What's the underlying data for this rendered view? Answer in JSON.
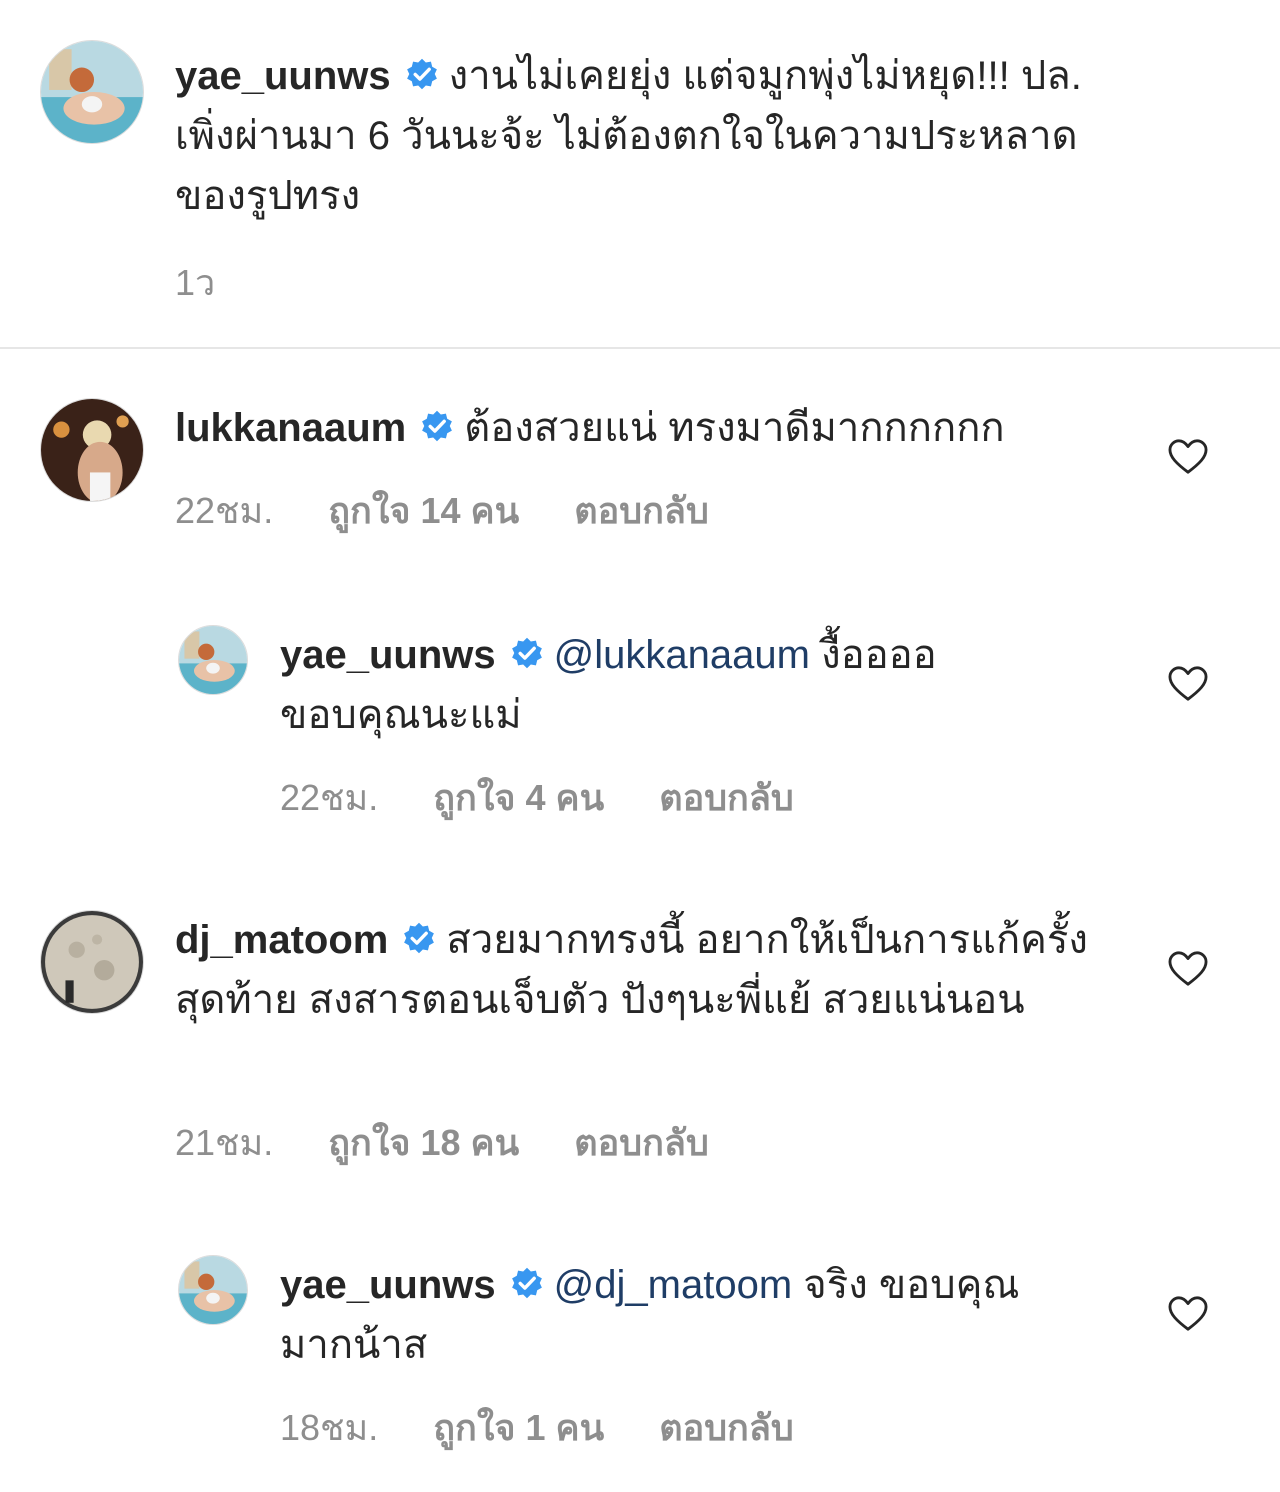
{
  "caption": {
    "username": "yae_uunws",
    "text": "งานไม่เคยยุ่ง แต่จมูกพุ่งไม่หยุด!!! ปล. เพิ่งผ่านมา 6 วันนะจ้ะ ไม่ต้องตกใจในความประหลาดของรูปทรง",
    "time": "1ว"
  },
  "comments": [
    {
      "username": "lukkanaaum",
      "mention": "",
      "text": "ต้องสวยแน่ ทรงมาดีมากกกกกก",
      "time": "22ชม.",
      "likes": "ถูกใจ 14 คน",
      "reply": "ตอบกลับ"
    },
    {
      "username": "yae_uunws",
      "mention": "@lukkanaaum",
      "text": "งื้ออออ ขอบคุณนะแม่",
      "time": "22ชม.",
      "likes": "ถูกใจ 4 คน",
      "reply": "ตอบกลับ"
    },
    {
      "username": "dj_matoom",
      "mention": "",
      "text": "สวยมากทรงนี้ อยากให้เป็นการแก้ครั้งสุดท้าย สงสารตอนเจ็บตัว ปังๆนะพี่แย้ สวยแน่นอน",
      "time": "21ชม.",
      "likes": "ถูกใจ 18 คน",
      "reply": "ตอบกลับ"
    },
    {
      "username": "yae_uunws",
      "mention": "@dj_matoom",
      "text": "จริง ขอบคุณมากน้าส",
      "time": "18ชม.",
      "likes": "ถูกใจ 1 คน",
      "reply": "ตอบกลับ"
    }
  ],
  "icons": {
    "verified": "verified-badge-icon",
    "like": "heart-outline-icon"
  },
  "colors": {
    "verified": "#3897f0",
    "text": "#262626",
    "secondary": "#8e8e8e",
    "mention": "#1f3d66",
    "divider": "#e6e6e6"
  }
}
